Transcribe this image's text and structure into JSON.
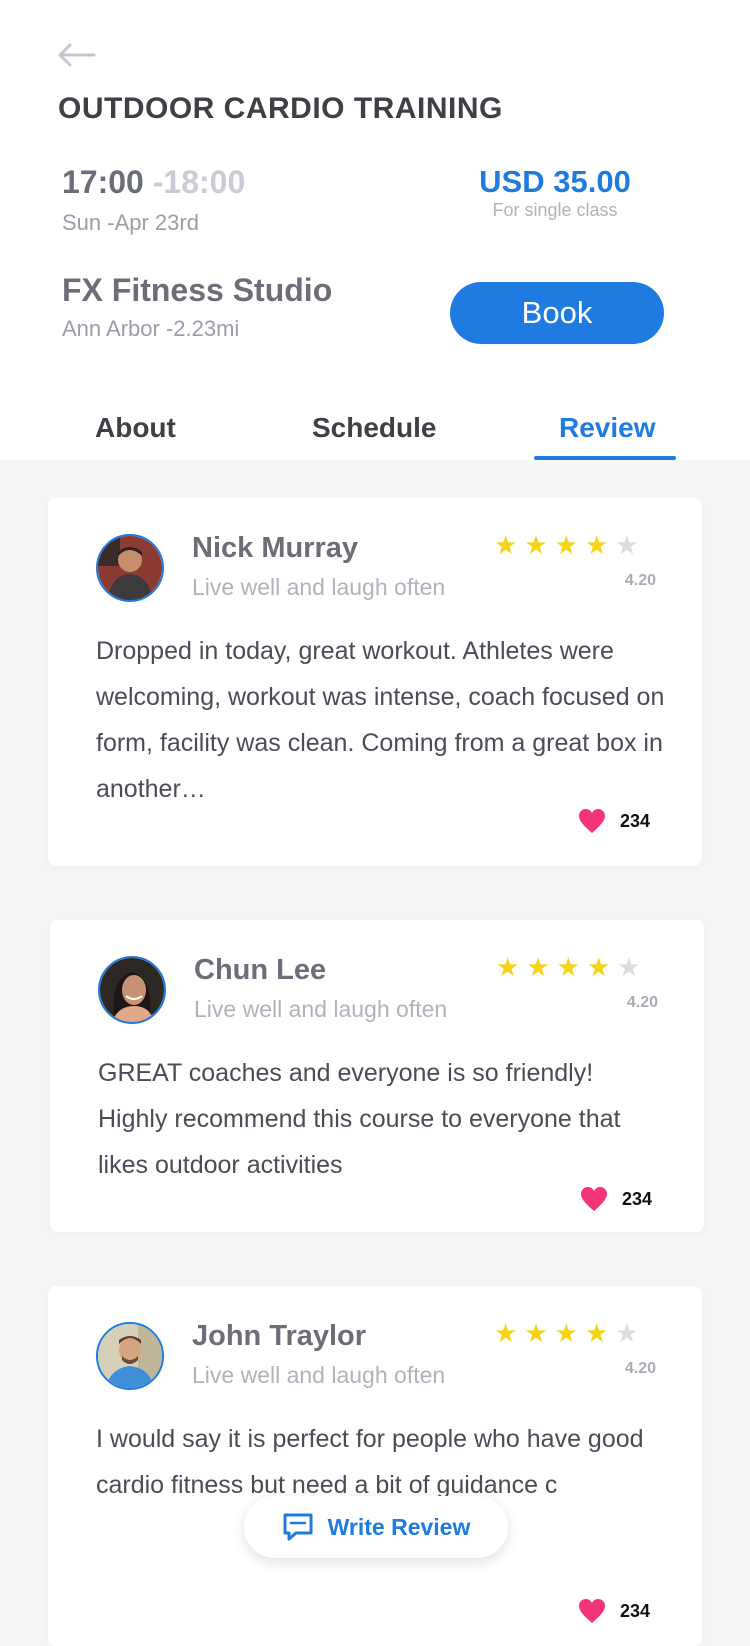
{
  "header": {
    "title": "OUTDOOR CARDIO TRAINING",
    "time_start": "17:00",
    "time_end": "-18:00",
    "date": "Sun -Apr 23rd",
    "price": "USD 35.00",
    "price_note": "For single class",
    "studio": "FX Fitness Studio",
    "location": "Ann Arbor -2.23mi",
    "book_label": "Book"
  },
  "tabs": [
    {
      "label": "About",
      "active": false
    },
    {
      "label": "Schedule",
      "active": false
    },
    {
      "label": "Review",
      "active": true
    }
  ],
  "reviews": [
    {
      "name": "Nick Murray",
      "motto": "Live well and laugh often",
      "stars": 4,
      "rating": "4.20",
      "text": "Dropped in today, great workout. Athletes were welcoming, workout was intense, coach focused on form, facility was clean. Coming from a great box in another…",
      "likes": "234"
    },
    {
      "name": "Chun Lee",
      "motto": "Live well and laugh often",
      "stars": 4,
      "rating": "4.20",
      "text": "GREAT coaches and everyone is so friendly! Highly recommend this course to everyone that likes outdoor activities",
      "likes": "234"
    },
    {
      "name": "John Traylor",
      "motto": "Live well and laugh often",
      "stars": 4,
      "rating": "4.20",
      "text": " I would say it is perfect for people who have good cardio fitness but need a bit of guidance c",
      "likes": "234"
    }
  ],
  "write_review_label": "Write Review",
  "colors": {
    "accent": "#1f7be0",
    "star": "#f7d318",
    "heart": "#f2357a"
  },
  "icons": {
    "back": "arrow-left-icon",
    "heart": "heart-icon",
    "write": "chat-bubble-icon",
    "star": "star-icon"
  }
}
